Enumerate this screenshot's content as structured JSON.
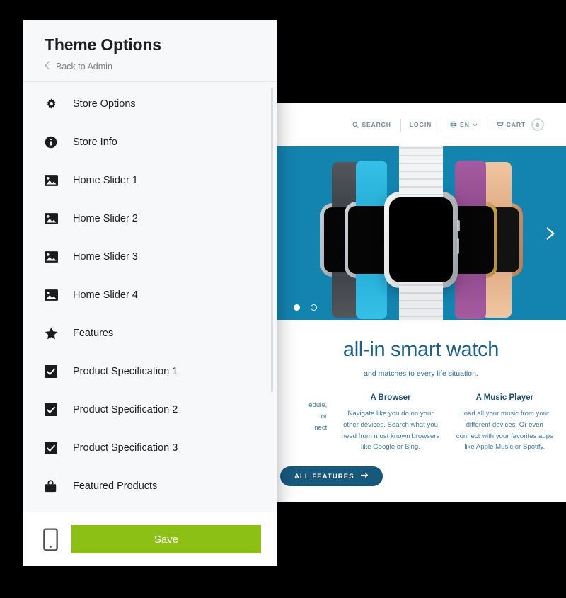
{
  "panel": {
    "title": "Theme Options",
    "back_label": "Back to Admin",
    "back_icon": "chevron-left-icon",
    "menu_items": [
      {
        "icon": "gear-icon",
        "label": "Store Options"
      },
      {
        "icon": "info-icon",
        "label": "Store Info"
      },
      {
        "icon": "image-icon",
        "label": "Home Slider 1"
      },
      {
        "icon": "image-icon",
        "label": "Home Slider 2"
      },
      {
        "icon": "image-icon",
        "label": "Home Slider 3"
      },
      {
        "icon": "image-icon",
        "label": "Home Slider 4"
      },
      {
        "icon": "star-icon",
        "label": "Features"
      },
      {
        "icon": "checkbox-icon",
        "label": "Product Specification 1"
      },
      {
        "icon": "checkbox-icon",
        "label": "Product Specification 2"
      },
      {
        "icon": "checkbox-icon",
        "label": "Product Specification 3"
      },
      {
        "icon": "shopping-bag-icon",
        "label": "Featured Products"
      }
    ],
    "footer": {
      "preview_icon": "mobile-phone-icon",
      "save_label": "Save",
      "save_color": "#8cc014"
    }
  },
  "site": {
    "nav": [
      {
        "icon": "search-icon",
        "label": "SEARCH"
      },
      {
        "icon": "",
        "label": "LOGIN"
      },
      {
        "icon": "globe-icon",
        "label": "EN",
        "caret": "chevron-down-icon"
      },
      {
        "icon": "cart-icon",
        "label": "CART",
        "badge": "0"
      }
    ],
    "banner": {
      "background_color": "#1383b0",
      "next_icon": "chevron-right-icon",
      "dots": [
        "active",
        "inactive"
      ]
    },
    "hero": {
      "heading": "all-in smart watch",
      "subheading": "and matches to every life situation."
    },
    "columns": [
      {
        "title": "",
        "body": "edule,\nor\nnect"
      },
      {
        "title": "A Browser",
        "body": "Navigate like you do on your other devices. Search what you need from most known browsers like Google or Bing."
      },
      {
        "title": "A Music Player",
        "body": "Load all your music from your different devices. Or even connect with your favorites apps like Apple Music or Spotify."
      }
    ],
    "cta": {
      "label": "ALL FEATURES",
      "icon": "arrow-right-icon",
      "color": "#17597d"
    }
  }
}
